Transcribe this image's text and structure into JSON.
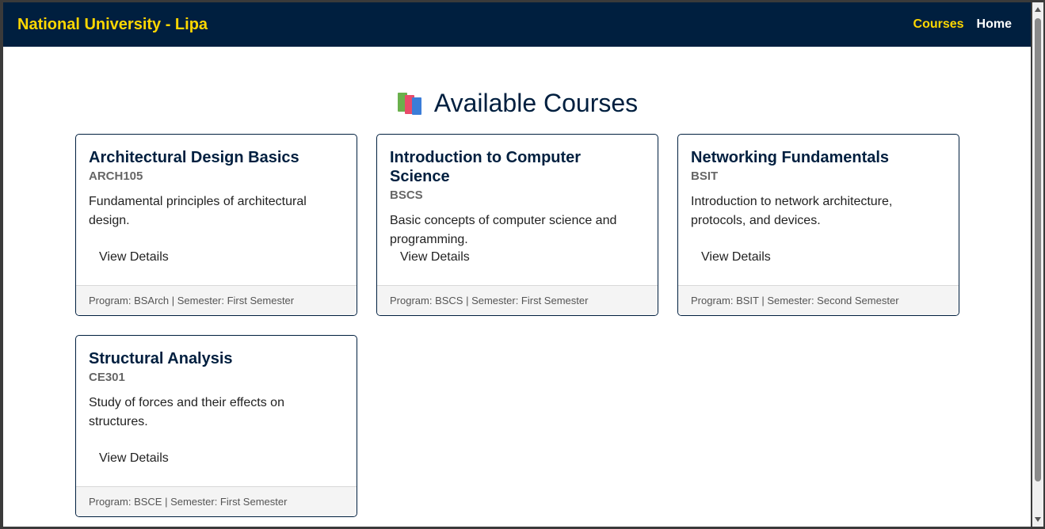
{
  "navbar": {
    "brand": "National University - Lipa",
    "links": [
      {
        "label": "Courses",
        "active": true
      },
      {
        "label": "Home",
        "active": false
      }
    ]
  },
  "main": {
    "title": "Available Courses",
    "title_icon": "books-icon"
  },
  "courses": [
    {
      "title": "Architectural Design Basics",
      "code": "ARCH105",
      "description": "Fundamental principles of architectural design.",
      "action": "View Details",
      "footer": "Program: BSArch | Semester: First Semester"
    },
    {
      "title": "Introduction to Computer Science",
      "code": "BSCS",
      "description": "Basic concepts of computer science and programming.",
      "action": "View Details",
      "footer": "Program: BSCS | Semester: First Semester"
    },
    {
      "title": "Networking Fundamentals",
      "code": "BSIT",
      "description": "Introduction to network architecture, protocols, and devices.",
      "action": "View Details",
      "footer": "Program: BSIT | Semester: Second Semester"
    },
    {
      "title": "Structural Analysis",
      "code": "CE301",
      "description": "Study of forces and their effects on structures.",
      "action": "View Details",
      "footer": "Program: BSCE | Semester: First Semester"
    }
  ],
  "colors": {
    "navbar_bg": "#001f3f",
    "accent": "#ffd700",
    "card_border": "#001f3f"
  }
}
